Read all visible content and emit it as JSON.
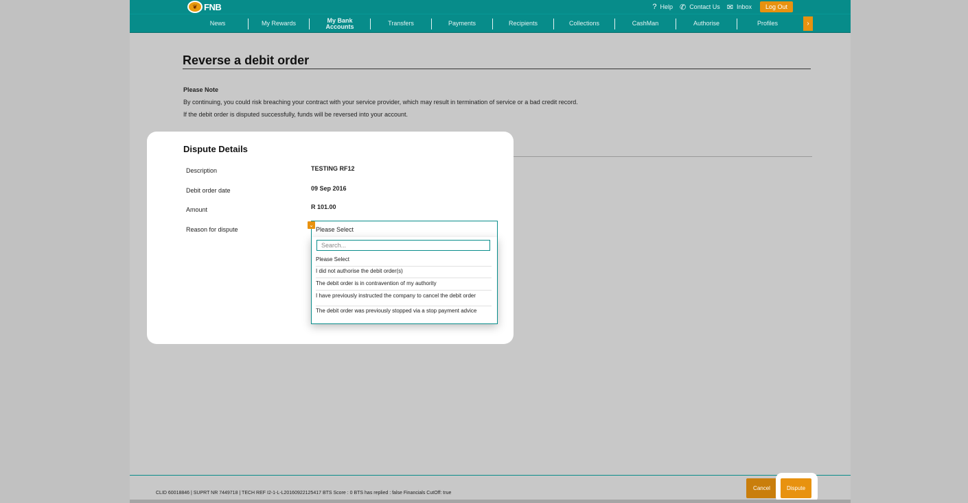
{
  "brand": {
    "name": "FNB"
  },
  "top_links": {
    "help": "Help",
    "contact": "Contact Us",
    "inbox": "Inbox",
    "logout": "Log Out"
  },
  "nav": {
    "items": [
      "News",
      "My Rewards",
      "My Bank Accounts",
      "Transfers",
      "Payments",
      "Recipients",
      "Collections",
      "CashMan",
      "Authorise",
      "Profiles"
    ]
  },
  "page": {
    "title": "Reverse a debit order",
    "note_heading": "Please Note",
    "note_line_1": "By continuing, you could risk breaching your contract with your service provider, which may result in termination of service or a bad credit record.",
    "note_line_2": "If the debit order is disputed successfully, funds will be reversed into your account."
  },
  "dispute": {
    "section_title": "Dispute Details",
    "rows": [
      {
        "label": "Description",
        "value": "TESTING RF12"
      },
      {
        "label": "Debit order date",
        "value": "09 Sep 2016"
      },
      {
        "label": "Amount",
        "value": "R 101.00"
      },
      {
        "label": "Reason for dispute",
        "value": ""
      }
    ],
    "select": {
      "current": "Please Select",
      "search_placeholder": "Search...",
      "options": [
        "Please Select",
        "I did not authorise the debit order(s)",
        "The debit order is in contravention of my authority",
        "I have previously instructed the company to cancel the debit order",
        "The debit order was previously stopped via a stop payment advice"
      ]
    }
  },
  "footer": {
    "text": "CLID 60018846 | SUPRT NR 7449718 | TECH REF I2-1-L-L20160922125417 BTS Score : 0 BTS has replied : false Financials CutOff: true",
    "cancel": "Cancel",
    "dispute": "Dispute"
  },
  "colors": {
    "teal": "#078c8a",
    "orange": "#e8920f",
    "background": "#c1c1c1"
  }
}
